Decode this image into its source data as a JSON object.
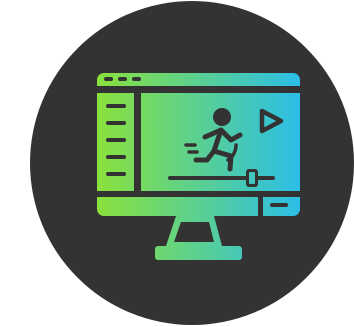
{
  "icon": {
    "name": "video-editing-monitor-icon",
    "colors": {
      "circle_background": "#333333",
      "gradient_start": "#8BE23A",
      "gradient_end": "#2BBEE8"
    }
  }
}
